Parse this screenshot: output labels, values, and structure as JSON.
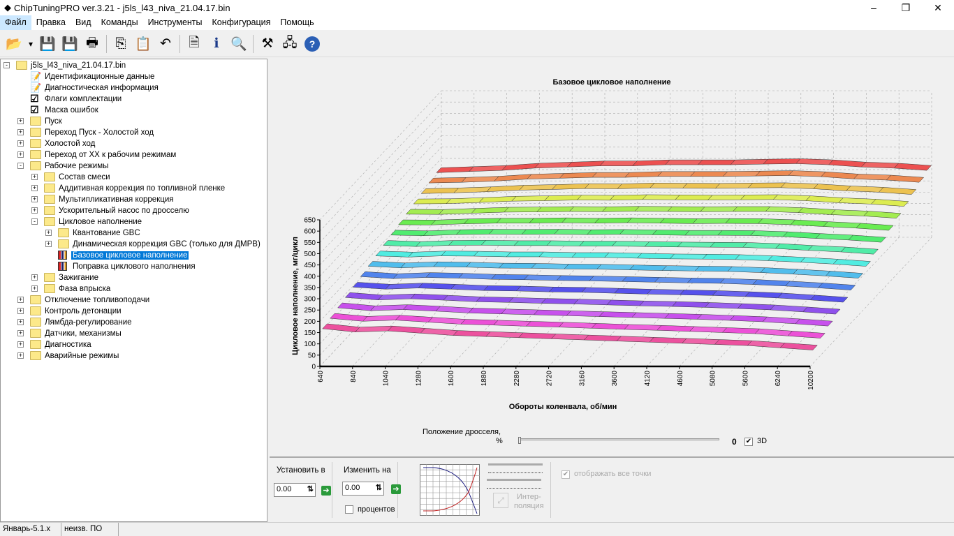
{
  "window": {
    "title": "ChipTuningPRO ver.3.21 - j5ls_l43_niva_21.04.17.bin",
    "minimize": "–",
    "maximize": "❐",
    "close": "✕"
  },
  "menu": [
    "Файл",
    "Правка",
    "Вид",
    "Команды",
    "Инструменты",
    "Конфигурация",
    "Помощь"
  ],
  "toolbar": [
    {
      "name": "open-icon",
      "glyph": "📂"
    },
    {
      "name": "dropdown-icon",
      "glyph": "▾"
    },
    {
      "name": "save-icon",
      "glyph": "💾"
    },
    {
      "name": "save-as-icon",
      "glyph": "💾"
    },
    {
      "name": "print-icon",
      "glyph": "🖶"
    },
    {
      "sep": true
    },
    {
      "name": "copy-icon",
      "glyph": "⎘"
    },
    {
      "name": "paste-icon",
      "glyph": "📋"
    },
    {
      "name": "undo-icon",
      "glyph": "↶"
    },
    {
      "sep": true
    },
    {
      "name": "document-search-icon",
      "glyph": "🗎"
    },
    {
      "name": "info-icon",
      "glyph": "ℹ"
    },
    {
      "name": "search-icon",
      "glyph": "🔍"
    },
    {
      "sep": true
    },
    {
      "name": "tools-icon",
      "glyph": "⚒"
    },
    {
      "name": "network-icon",
      "glyph": "🖧"
    },
    {
      "name": "help-icon",
      "glyph": "?"
    }
  ],
  "tree": [
    {
      "label": "j5ls_l43_niva_21.04.17.bin",
      "level": 0,
      "exp": "-",
      "icon": "folder"
    },
    {
      "label": "Идентификационные данные",
      "level": 1,
      "icon": "doc"
    },
    {
      "label": "Диагностическая информация",
      "level": 1,
      "icon": "doc"
    },
    {
      "label": "Флаги комплектации",
      "level": 1,
      "icon": "check"
    },
    {
      "label": "Маска ошибок",
      "level": 1,
      "icon": "check"
    },
    {
      "label": "Пуск",
      "level": 1,
      "exp": "+",
      "icon": "folder"
    },
    {
      "label": "Переход Пуск - Холостой ход",
      "level": 1,
      "exp": "+",
      "icon": "folder"
    },
    {
      "label": "Холостой ход",
      "level": 1,
      "exp": "+",
      "icon": "folder"
    },
    {
      "label": "Переход от ХХ к рабочим режимам",
      "level": 1,
      "exp": "+",
      "icon": "folder"
    },
    {
      "label": "Рабочие режимы",
      "level": 1,
      "exp": "-",
      "icon": "folder"
    },
    {
      "label": "Состав смеси",
      "level": 2,
      "exp": "+",
      "icon": "folder"
    },
    {
      "label": "Аддитивная коррекция по топливной пленке",
      "level": 2,
      "exp": "+",
      "icon": "folder"
    },
    {
      "label": "Мультипликативная коррекция",
      "level": 2,
      "exp": "+",
      "icon": "folder"
    },
    {
      "label": "Ускорительный насос по дросселю",
      "level": 2,
      "exp": "+",
      "icon": "folder"
    },
    {
      "label": "Цикловое наполнение",
      "level": 2,
      "exp": "-",
      "icon": "folder"
    },
    {
      "label": "Квантование GBC",
      "level": 3,
      "exp": "+",
      "icon": "folder"
    },
    {
      "label": "Динамическая коррекция GBC (только для ДМРВ)",
      "level": 3,
      "exp": "+",
      "icon": "folder"
    },
    {
      "label": "Базовое цикловое наполнение",
      "level": 3,
      "icon": "chart",
      "selected": true
    },
    {
      "label": "Поправка циклового наполнения",
      "level": 3,
      "icon": "chart"
    },
    {
      "label": "Зажигание",
      "level": 2,
      "exp": "+",
      "icon": "folder"
    },
    {
      "label": "Фаза впрыска",
      "level": 2,
      "exp": "+",
      "icon": "folder"
    },
    {
      "label": "Отключение топливоподачи",
      "level": 1,
      "exp": "+",
      "icon": "folder"
    },
    {
      "label": "Контроль детонации",
      "level": 1,
      "exp": "+",
      "icon": "folder"
    },
    {
      "label": "Лямбда-регулирование",
      "level": 1,
      "exp": "+",
      "icon": "folder"
    },
    {
      "label": "Датчики, механизмы",
      "level": 1,
      "exp": "+",
      "icon": "folder"
    },
    {
      "label": "Диагностика",
      "level": 1,
      "exp": "+",
      "icon": "folder"
    },
    {
      "label": "Аварийные режимы",
      "level": 1,
      "exp": "+",
      "icon": "folder"
    }
  ],
  "chart_data": {
    "type": "surface-3d",
    "title": "Базовое цикловое наполнение",
    "xlabel": "Обороты коленвала, об/мин",
    "ylabel": "Цикловое наполнение, мг/цикл",
    "x": [
      "640",
      "840",
      "1040",
      "1280",
      "1600",
      "1880",
      "2280",
      "2720",
      "3160",
      "3600",
      "4120",
      "4600",
      "5080",
      "5600",
      "6240",
      "10200"
    ],
    "ylim": [
      0,
      650
    ],
    "yticks": [
      0,
      50,
      100,
      150,
      200,
      250,
      300,
      350,
      400,
      450,
      500,
      550,
      600,
      650
    ],
    "grid": true,
    "colors": "pink (front) → violet → blue → cyan → green → yellow → orange → red (back)",
    "rows": [
      [
        155,
        140,
        145,
        135,
        125,
        120,
        115,
        110,
        105,
        100,
        95,
        90,
        85,
        80,
        70,
        60
      ],
      [
        165,
        152,
        157,
        148,
        139,
        135,
        130,
        126,
        121,
        116,
        112,
        107,
        102,
        97,
        87,
        77
      ],
      [
        176,
        163,
        168,
        161,
        153,
        149,
        145,
        141,
        137,
        133,
        129,
        125,
        120,
        114,
        105,
        95
      ],
      [
        186,
        175,
        180,
        174,
        167,
        164,
        160,
        157,
        153,
        149,
        146,
        142,
        137,
        131,
        122,
        112
      ],
      [
        196,
        187,
        192,
        187,
        181,
        179,
        175,
        173,
        169,
        165,
        162,
        159,
        154,
        148,
        139,
        129
      ],
      [
        207,
        198,
        203,
        200,
        195,
        193,
        190,
        188,
        185,
        182,
        179,
        177,
        172,
        165,
        157,
        147
      ],
      [
        217,
        210,
        215,
        213,
        209,
        208,
        205,
        204,
        201,
        198,
        196,
        194,
        189,
        182,
        174,
        164
      ],
      [
        227,
        222,
        227,
        226,
        223,
        223,
        220,
        220,
        217,
        214,
        213,
        211,
        206,
        199,
        191,
        181
      ],
      [
        238,
        233,
        238,
        239,
        237,
        237,
        235,
        235,
        233,
        231,
        230,
        229,
        224,
        216,
        209,
        199
      ],
      [
        248,
        245,
        250,
        252,
        251,
        252,
        250,
        251,
        249,
        247,
        247,
        246,
        241,
        233,
        226,
        216
      ],
      [
        258,
        257,
        262,
        265,
        265,
        267,
        265,
        267,
        265,
        263,
        264,
        263,
        258,
        250,
        243,
        233
      ],
      [
        269,
        268,
        273,
        278,
        279,
        281,
        280,
        282,
        281,
        280,
        281,
        281,
        276,
        267,
        261,
        251
      ],
      [
        279,
        280,
        285,
        291,
        293,
        296,
        295,
        298,
        297,
        296,
        297,
        298,
        293,
        284,
        278,
        268
      ],
      [
        289,
        292,
        297,
        304,
        307,
        311,
        310,
        314,
        313,
        312,
        314,
        315,
        310,
        301,
        295,
        285
      ],
      [
        300,
        303,
        308,
        317,
        321,
        325,
        325,
        329,
        329,
        329,
        331,
        333,
        328,
        318,
        313,
        303
      ],
      [
        310,
        315,
        320,
        330,
        335,
        340,
        340,
        345,
        345,
        345,
        348,
        350,
        345,
        335,
        330,
        320
      ]
    ]
  },
  "throttle": {
    "label": "Положение дросселя,",
    "unit": "%",
    "value": "0",
    "value_fraction": 0,
    "checkbox_label": "3D",
    "checked": true
  },
  "edit": {
    "set_label": "Установить в",
    "set_value": "0.00",
    "change_label": "Изменить на",
    "change_value": "0.00",
    "percent_label": "процентов",
    "interp_label1": "Интер-",
    "interp_label2": "поляция",
    "show_all_label": "отображать все точки"
  },
  "status": [
    "Январь-5.1.x",
    "неизв. ПО"
  ]
}
